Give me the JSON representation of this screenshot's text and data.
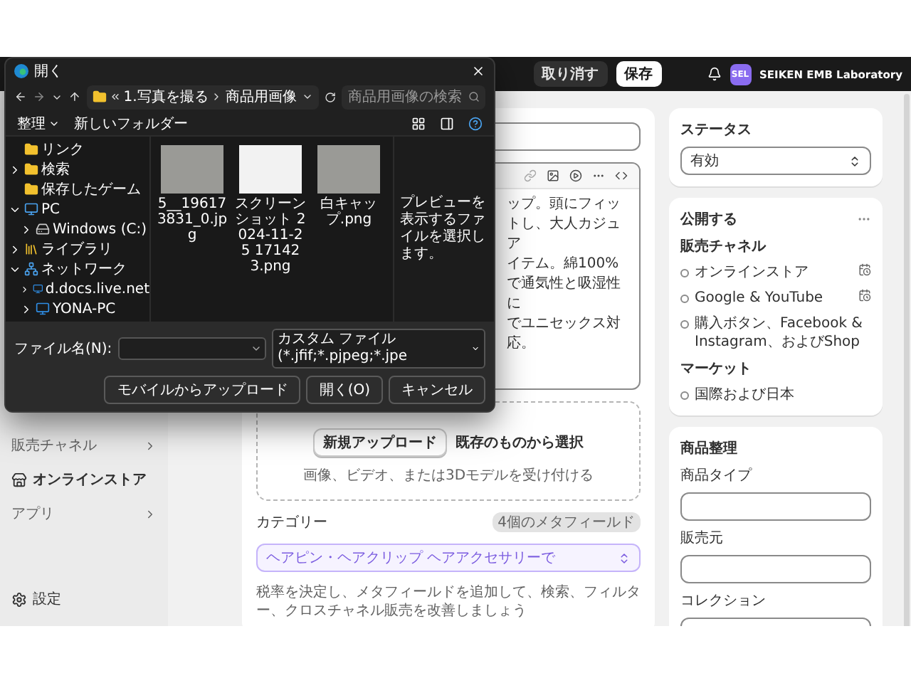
{
  "topbar": {
    "discard": "取り消す",
    "save": "保存",
    "avatar": "SEL",
    "store_name": "SEIKEN EMB Laboratory"
  },
  "sidebar": {
    "items": [
      {
        "kind": "header",
        "label": "販売チャネル"
      },
      {
        "kind": "link",
        "label": "オンラインストア"
      },
      {
        "kind": "header",
        "label": "アプリ"
      }
    ],
    "settings": "設定"
  },
  "product": {
    "description_lines": [
      "ップ。頭にフィットし、大人カジュア",
      "イテム。綿100%で通気性と吸湿性に",
      "でユニセックス対応。"
    ],
    "media": {
      "upload": "新規アップロード",
      "select_existing": "既存のものから選択",
      "hint": "画像、ビデオ、または3Dモデルを受け付ける"
    },
    "category": {
      "label": "カテゴリー",
      "badge": "4個のメタフィールド",
      "value": "ヘアピン・ヘアクリップ ヘアアクセサリーで",
      "help": "税率を決定し、メタフィールドを追加して、検索、フィルター、クロスチャネル販売を改善しましょう"
    }
  },
  "status": {
    "title": "ステータス",
    "value": "有効"
  },
  "publishing": {
    "title": "公開する",
    "channels_title": "販売チャネル",
    "channels": [
      {
        "name": "オンラインストア",
        "scheduled": true
      },
      {
        "name": "Google & YouTube",
        "scheduled": true
      },
      {
        "name": "購入ボタン、Facebook & Instagram、およびShop",
        "scheduled": false
      }
    ],
    "markets_title": "マーケット",
    "markets": [
      "国際および日本"
    ]
  },
  "organization": {
    "title": "商品整理",
    "fields": [
      {
        "label": "商品タイプ"
      },
      {
        "label": "販売元"
      },
      {
        "label": "コレクション"
      }
    ]
  },
  "dialog": {
    "title": "開く",
    "path": [
      "1.写真を撮る",
      "商品用画像"
    ],
    "search": {
      "placeholder": "商品用画像の検索"
    },
    "toolbar": {
      "organize": "整理",
      "new_folder": "新しいフォルダー"
    },
    "tree": [
      {
        "kind": "folder",
        "label": "リンク"
      },
      {
        "kind": "folder",
        "label": "検索",
        "expanded": false
      },
      {
        "kind": "folder",
        "label": "保存したゲーム"
      },
      {
        "kind": "pc",
        "label": "PC",
        "expanded": true,
        "children": [
          {
            "kind": "drive",
            "label": "Windows (C:)",
            "expanded": false
          }
        ]
      },
      {
        "kind": "library",
        "label": "ライブラリ",
        "expanded": false
      },
      {
        "kind": "network",
        "label": "ネットワーク",
        "expanded": true,
        "children": [
          {
            "kind": "computer",
            "label": "d.docs.live.net",
            "expanded": false
          },
          {
            "kind": "computer",
            "label": "YONA-PC",
            "expanded": false
          }
        ]
      }
    ],
    "files": [
      {
        "name": "5__196173831_0.jpg",
        "kind": "photo",
        "selected": false
      },
      {
        "name": "スクリーンショット 2024-11-25 171423.png",
        "kind": "screenshot",
        "selected": false
      },
      {
        "name": "白キャップ.png",
        "kind": "photo",
        "selected": false
      }
    ],
    "preview": "プレビューを表示するファイルを選択します。",
    "file_name": {
      "label": "ファイル名(N):"
    },
    "file_type": "カスタム ファイル (*.jfif;*.pjpeg;*.jpe",
    "buttons": [
      {
        "label": "モバイルからアップロード"
      },
      {
        "label": "開く(O)"
      },
      {
        "label": "キャンセル"
      }
    ]
  }
}
